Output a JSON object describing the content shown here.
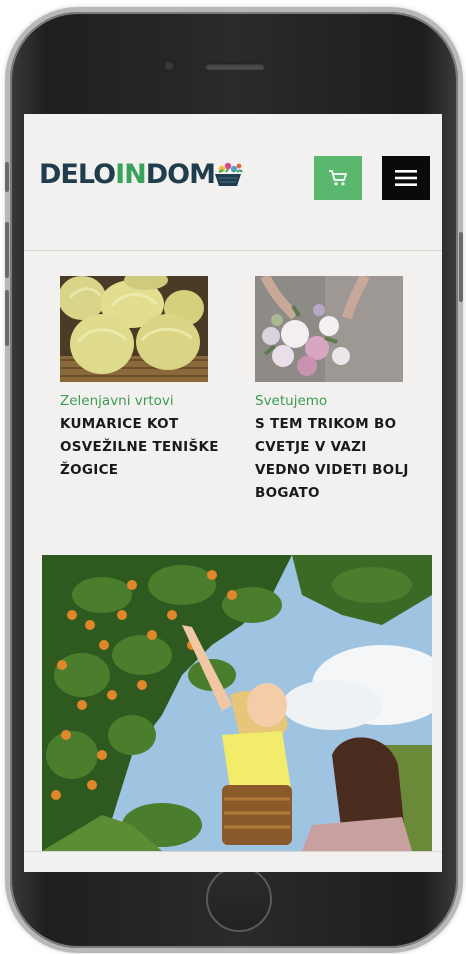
{
  "brand": {
    "logo_part1": "DELO",
    "logo_part2": "IN",
    "logo_part3": "DOM",
    "accent_green": "#59b86e",
    "dark_blue": "#1f3d4c"
  },
  "header": {
    "cart_icon": "shopping-cart-icon",
    "menu_icon": "hamburger-menu-icon"
  },
  "articles": [
    {
      "category": "Zelenjavni vrtovi",
      "title": "KUMARICE KOT OSVEŽILNE TENIŠKE ŽOGICE",
      "image": "yellow-round-cucumbers-in-basket"
    },
    {
      "category": "Svetujemo",
      "title": "S TEM TRIKOM BO CVETJE V VAZI VEDNO VIDETI BOLJ BOGATO",
      "image": "flower-bouquet-arranging"
    }
  ],
  "feature": {
    "image": "children-picking-apricots-from-tree"
  }
}
